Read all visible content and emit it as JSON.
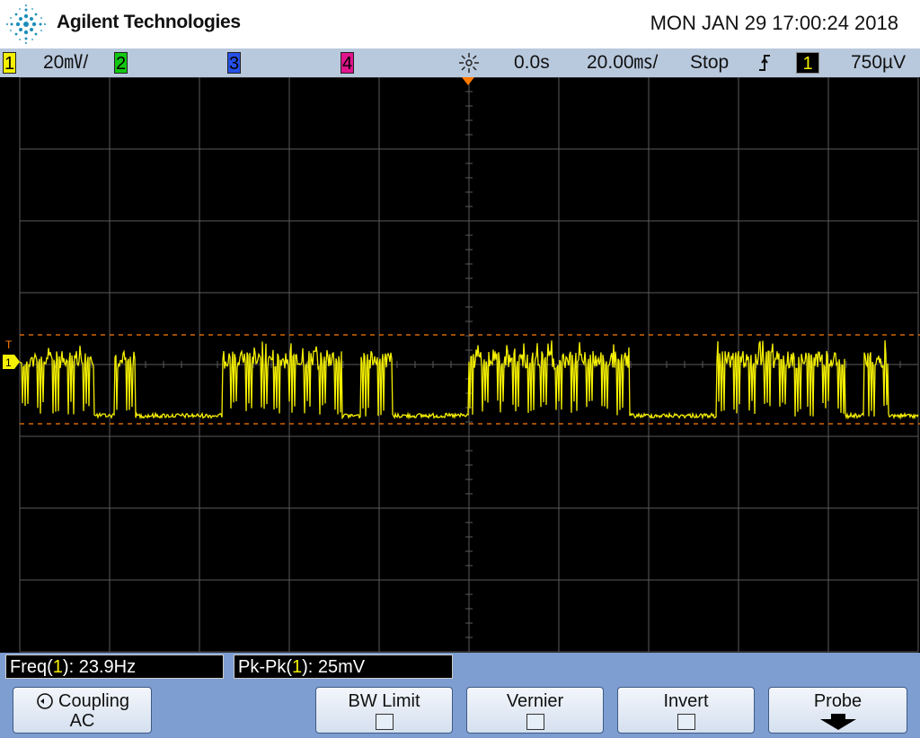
{
  "header": {
    "brand": "Agilent Technologies",
    "datetime": "MON JAN 29 17:00:24 2018"
  },
  "status": {
    "ch1_label": "1",
    "ch1_scale": "20㎷/",
    "ch2_label": "2",
    "ch3_label": "3",
    "ch4_label": "4",
    "time_delay": "0.0s",
    "time_scale": "20.00㎳/",
    "run_state": "Stop",
    "trigger_source": "1",
    "trigger_level": "750µV",
    "trigger_slope_icon": "rising-edge-icon"
  },
  "screen": {
    "ground_marker": "1",
    "trigger_marker": "T"
  },
  "measurements": [
    {
      "name": "Freq(",
      "channel": "1",
      "suffix": "): 23.9Hz"
    },
    {
      "name": "Pk-Pk(",
      "channel": "1",
      "suffix": "): 25mV"
    }
  ],
  "softkeys": {
    "coupling_label": "Coupling",
    "coupling_value": "AC",
    "bw_limit": "BW Limit",
    "vernier": "Vernier",
    "invert": "Invert",
    "probe": "Probe"
  },
  "colors": {
    "trace": "#f5f000",
    "cursor": "#ff7a00",
    "grid": "#5a5a5a",
    "statusbar": "#b9c9dd",
    "softbar": "#7e9ed1"
  }
}
